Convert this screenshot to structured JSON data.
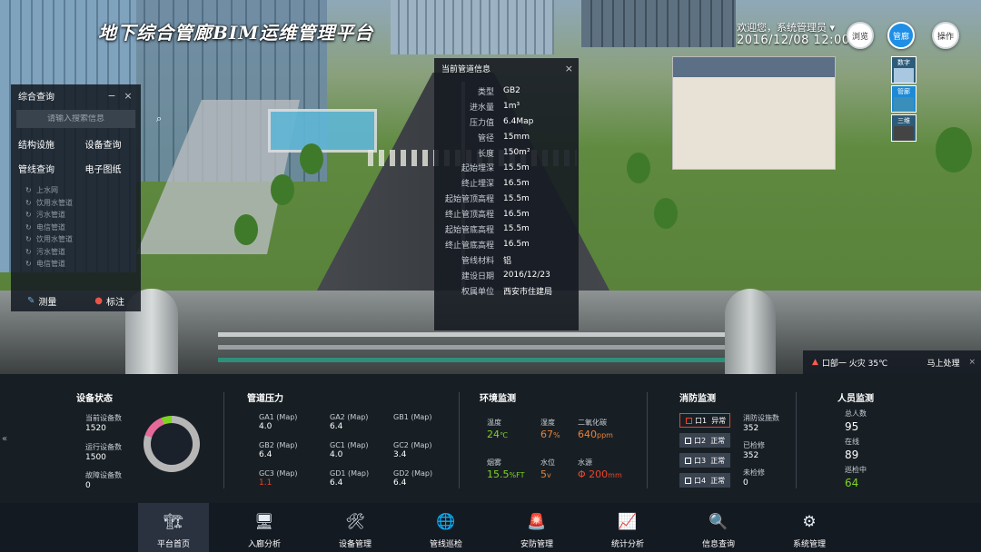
{
  "header": {
    "app_title": "地下综合管廊BIM运维管理平台",
    "welcome": "欢迎您，系统管理员",
    "datetime": "2016/12/08 12:00",
    "buttons": [
      "浏览",
      "管廊",
      "操作"
    ],
    "active_button": 1
  },
  "view_tabs": [
    "数字",
    "管廊",
    "三维"
  ],
  "query_panel": {
    "title": "综合查询",
    "search_placeholder": "请输入搜索信息",
    "categories": [
      "结构设施",
      "设备查询",
      "管线查询",
      "电子图纸"
    ],
    "pipe_list": [
      "上水网",
      "饮用水管道",
      "污水管道",
      "电信管道",
      "饮用水管道",
      "污水管道",
      "电信管道"
    ],
    "measure_label": "测量",
    "mark_label": "标注"
  },
  "pipe_info": {
    "title": "当前管道信息",
    "rows": [
      {
        "k": "类型",
        "v": "GB2"
      },
      {
        "k": "进水量",
        "v": "1m³"
      },
      {
        "k": "压力值",
        "v": "6.4Map"
      },
      {
        "k": "管径",
        "v": "15mm"
      },
      {
        "k": "长度",
        "v": "150m²"
      },
      {
        "k": "起始埋深",
        "v": "15.5m"
      },
      {
        "k": "终止埋深",
        "v": "16.5m"
      },
      {
        "k": "起始管顶高程",
        "v": "15.5m"
      },
      {
        "k": "终止管顶高程",
        "v": "16.5m"
      },
      {
        "k": "起始管底高程",
        "v": "15.5m"
      },
      {
        "k": "终止管底高程",
        "v": "16.5m"
      },
      {
        "k": "管线材料",
        "v": "铝"
      },
      {
        "k": "建设日期",
        "v": "2016/12/23"
      },
      {
        "k": "权属单位",
        "v": "西安市住建局"
      }
    ]
  },
  "alert": {
    "text": "口部一 火灾 35℃",
    "action": "马上处理"
  },
  "device_status": {
    "title": "设备状态",
    "items": [
      {
        "label": "当前设备数",
        "value": "1520"
      },
      {
        "label": "运行设备数",
        "value": "1500"
      },
      {
        "label": "故障设备数",
        "value": "0"
      }
    ],
    "ring_colors": [
      "#b6b6b6",
      "#e56a9a",
      "#7ed321"
    ]
  },
  "pipe_pressure": {
    "title": "管道压力",
    "items": [
      {
        "label": "GA1 (Map)",
        "value": "4.0",
        "warn": false
      },
      {
        "label": "GA2 (Map)",
        "value": "6.4",
        "warn": false
      },
      {
        "label": "GB1 (Map)",
        "value": "",
        "warn": false
      },
      {
        "label": "GB2 (Map)",
        "value": "6.4",
        "warn": false
      },
      {
        "label": "GC1 (Map)",
        "value": "4.0",
        "warn": false
      },
      {
        "label": "GC2 (Map)",
        "value": "3.4",
        "warn": false
      },
      {
        "label": "GC3 (Map)",
        "value": "1.1",
        "warn": true
      },
      {
        "label": "GD1 (Map)",
        "value": "6.4",
        "warn": false
      },
      {
        "label": "GD2 (Map)",
        "value": "6.4",
        "warn": false
      }
    ]
  },
  "environment": {
    "title": "环境监测",
    "items": [
      {
        "label": "温度",
        "value": "24",
        "unit": "℃",
        "color": "green"
      },
      {
        "label": "湿度",
        "value": "67",
        "unit": "%",
        "color": "orange"
      },
      {
        "label": "二氧化碳",
        "value": "640",
        "unit": "ppm",
        "color": "orange"
      },
      {
        "label": "烟雾",
        "value": "15.5",
        "unit": "%FT",
        "color": "green"
      },
      {
        "label": "水位",
        "value": "5",
        "unit": "v",
        "color": "orange"
      },
      {
        "label": "水源",
        "value": "Φ 200",
        "unit": "mm",
        "color": "red"
      }
    ]
  },
  "fire": {
    "title": "消防监测",
    "zones": [
      {
        "label": "口1",
        "status": "异常",
        "alarm": true
      },
      {
        "label": "口2",
        "status": "正常",
        "alarm": false
      },
      {
        "label": "口3",
        "status": "正常",
        "alarm": false
      },
      {
        "label": "口4",
        "status": "正常",
        "alarm": false
      }
    ],
    "stats": [
      {
        "label": "消防设施数",
        "value": "352"
      },
      {
        "label": "已检修",
        "value": "352"
      },
      {
        "label": "未检修",
        "value": "0"
      }
    ]
  },
  "personnel": {
    "title": "人员监测",
    "items": [
      {
        "label": "总人数",
        "value": "95",
        "color": "white"
      },
      {
        "label": "在线",
        "value": "89",
        "color": "white"
      },
      {
        "label": "巡检中",
        "value": "64",
        "color": "green"
      }
    ]
  },
  "nav": {
    "active": 0,
    "items": [
      {
        "label": "平台首页",
        "icon": "platform-home-icon",
        "glyph": "🏗"
      },
      {
        "label": "入廊分析",
        "icon": "monitor-icon",
        "glyph": "🖥"
      },
      {
        "label": "设备管理",
        "icon": "tools-icon",
        "glyph": "🛠"
      },
      {
        "label": "管线巡检",
        "icon": "globe-icon",
        "glyph": "🌐"
      },
      {
        "label": "安防管理",
        "icon": "alarm-light-icon",
        "glyph": "🚨"
      },
      {
        "label": "统计分析",
        "icon": "chart-icon",
        "glyph": "📈"
      },
      {
        "label": "信息查询",
        "icon": "magnifier-icon",
        "glyph": "🔍"
      },
      {
        "label": "系统管理",
        "icon": "gear-icon",
        "glyph": "⚙"
      }
    ]
  }
}
